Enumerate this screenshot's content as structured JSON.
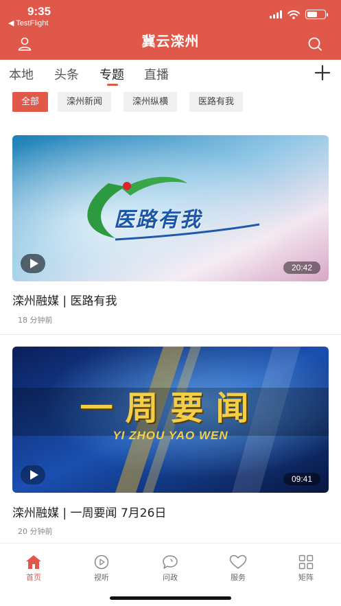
{
  "status_bar": {
    "time": "9:35",
    "back_app": "◀ TestFlight"
  },
  "header": {
    "title": "冀云滦州",
    "user_icon": "user-icon",
    "search_icon": "search-icon"
  },
  "tabs": [
    {
      "label": "本地",
      "active": false
    },
    {
      "label": "头条",
      "active": false
    },
    {
      "label": "专题",
      "active": true
    },
    {
      "label": "直播",
      "active": false
    }
  ],
  "chips": [
    {
      "label": "全部",
      "active": true
    },
    {
      "label": "滦州新闻",
      "active": false
    },
    {
      "label": "滦州纵横",
      "active": false
    },
    {
      "label": "医路有我",
      "active": false
    }
  ],
  "videos": [
    {
      "title": "滦州融媒 | 医路有我",
      "time": "18 分钟前",
      "duration": "20:42",
      "thumb_text": "医路有我"
    },
    {
      "title": "滦州融媒 | 一周要闻 7月26日",
      "time": "20 分钟前",
      "duration": "09:41",
      "thumb_text": "一周要闻",
      "thumb_subtext": "YI ZHOU YAO WEN"
    }
  ],
  "bottom_nav": [
    {
      "label": "首页",
      "icon": "home-icon",
      "active": true
    },
    {
      "label": "视听",
      "icon": "play-circle-icon",
      "active": false
    },
    {
      "label": "问政",
      "icon": "chat-bubble-icon",
      "active": false
    },
    {
      "label": "服务",
      "icon": "heart-icon",
      "active": false
    },
    {
      "label": "矩阵",
      "icon": "grid-icon",
      "active": false
    }
  ],
  "colors": {
    "brand": "#e0584a",
    "text": "#222222",
    "muted": "#888888"
  }
}
